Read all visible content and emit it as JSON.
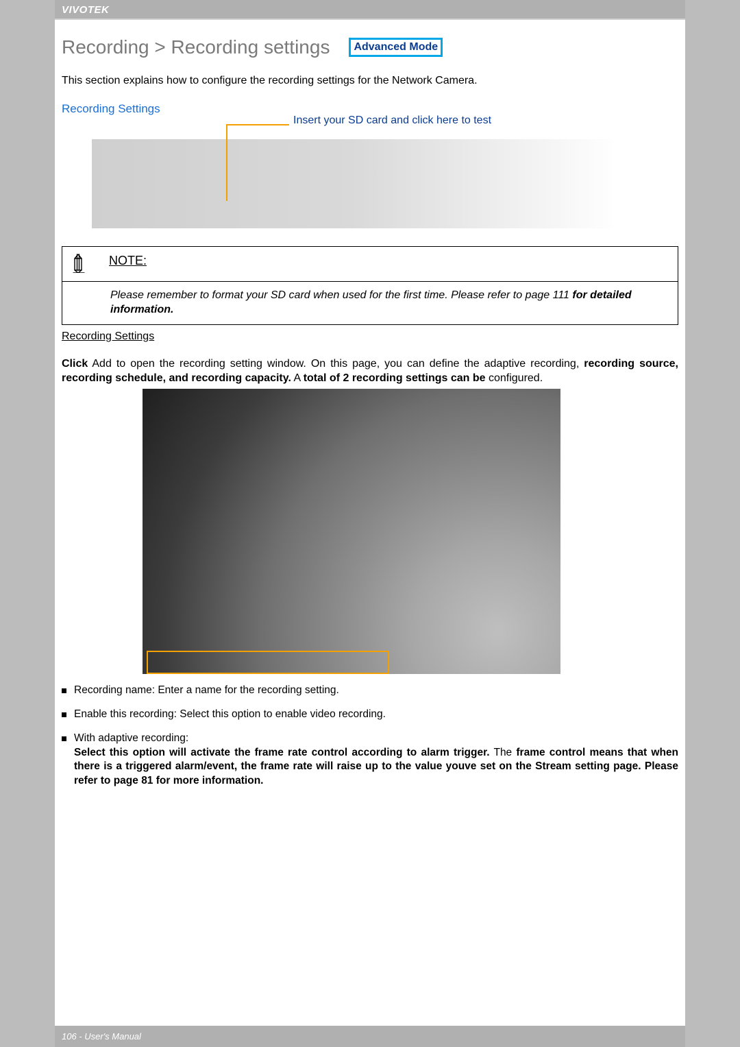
{
  "header": {
    "brand": "VIVOTEK"
  },
  "title": "Recording > Recording settings",
  "badge": "Advanced Mode",
  "intro": "This section explains how to configure the recording settings for the Network Camera.",
  "section_link": "Recording Settings",
  "insert_link": "Insert your SD card and click here to test",
  "note": {
    "title": "NOTE:",
    "body_plain": "Please remember to format your SD card when used for the first time. Please refer to page 111 ",
    "body_bold": "for detailed information."
  },
  "rs_heading": "Recording Settings",
  "para": {
    "p1_b1": "Click",
    "p1_t1": " Add  to open the recording setting window. On this page, you can define the adaptive recording, ",
    "p1_b2": "recording source, recording schedule, and recording capacity.",
    "p1_t2": " A ",
    "p1_b3": "total of 2 recording settings can be",
    "p1_t3": " configured."
  },
  "bullets": {
    "b1": "Recording name: Enter a name for the recording setting.",
    "b2": "Enable this recording: Select this option to enable video recording.",
    "b3_lead": "With adaptive recording:",
    "b3_bold1": "Select this option will activate the frame rate control according to alarm trigger.",
    "b3_plain1": " The ",
    "b3_bold2": "frame control means that when there is a triggered alarm/event, the frame rate will raise up to the value youve set on the Stream setting page. Please refer to page 81 for more information."
  },
  "footer": "106 - User's Manual"
}
